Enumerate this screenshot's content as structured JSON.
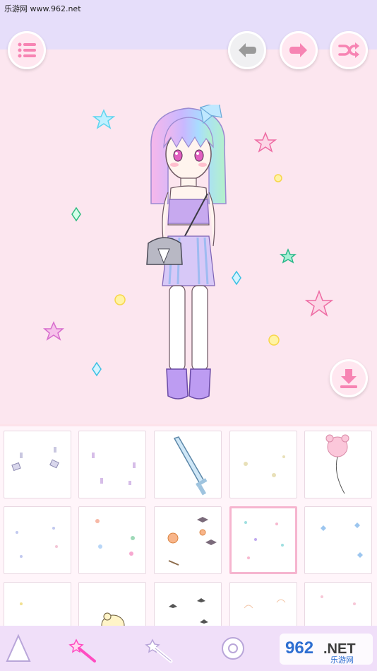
{
  "watermark": {
    "site_text": "乐游网 www.962.net"
  },
  "toolbar": {
    "menu_icon": "menu-icon",
    "undo_icon": "undo-icon",
    "redo_icon": "redo-icon",
    "shuffle_icon": "shuffle-icon",
    "save_icon": "download-icon"
  },
  "item_grid": {
    "tiles": [
      {
        "name": "item-paper-petals"
      },
      {
        "name": "item-small-sparkles"
      },
      {
        "name": "item-sword"
      },
      {
        "name": "item-twinkle-stars"
      },
      {
        "name": "item-bear-balloon"
      },
      {
        "name": "item-confetti-blue"
      },
      {
        "name": "item-confetti-colorful"
      },
      {
        "name": "item-halloween-set"
      },
      {
        "name": "item-pastel-confetti",
        "selected": true
      },
      {
        "name": "item-blue-butterflies"
      },
      {
        "name": "item-yellow-dots"
      },
      {
        "name": "item-chick-character"
      },
      {
        "name": "item-bats"
      },
      {
        "name": "item-cloud-lines"
      },
      {
        "name": "item-pink-petals"
      }
    ]
  },
  "bottom_tabs": [
    {
      "name": "tab-wardrobe",
      "icon": "hanger-icon"
    },
    {
      "name": "tab-magic-wand-active",
      "icon": "magic-wand-icon",
      "active": true
    },
    {
      "name": "tab-magic-wand",
      "icon": "magic-wand-icon"
    },
    {
      "name": "tab-settings",
      "icon": "gear-icon"
    }
  ],
  "watermark_logo": {
    "number": "962",
    "suffix": ".NET",
    "chinese": "乐游网"
  },
  "colors": {
    "background_pink": "#fce6ef",
    "header_lavender": "#e6defa",
    "button_pink": "#f784b3",
    "button_grey": "#9a9a9a",
    "bottom_bar": "#f0dff9",
    "selected_tile_border": "#f6b5cf"
  }
}
